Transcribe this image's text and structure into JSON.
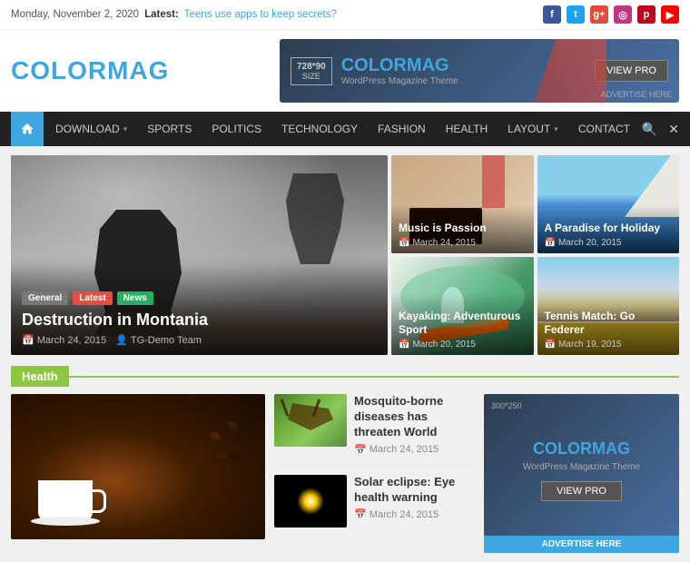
{
  "topbar": {
    "date": "Monday, November 2, 2020",
    "latest_label": "Latest:",
    "latest_link": "Teens use apps to keep secrets?",
    "social": [
      "fb",
      "tw",
      "gp",
      "ig",
      "pi",
      "yt"
    ]
  },
  "header": {
    "logo_black": "COLOR",
    "logo_blue": "MAG",
    "banner": {
      "size": "728*90",
      "size_sub": "SIZE",
      "logo_black": "COLOR",
      "logo_blue": "MAG",
      "tagline": "WordPress Magazine Theme",
      "btn_label": "VIEW PRO",
      "advertise": "ADVERTISE HERE"
    }
  },
  "nav": {
    "items": [
      {
        "label": "DOWNLOAD",
        "has_arrow": true
      },
      {
        "label": "SPORTS",
        "has_arrow": false
      },
      {
        "label": "POLITICS",
        "has_arrow": false
      },
      {
        "label": "TECHNOLOGY",
        "has_arrow": false
      },
      {
        "label": "FASHION",
        "has_arrow": false
      },
      {
        "label": "HEALTH",
        "has_arrow": false
      },
      {
        "label": "LAYOUT",
        "has_arrow": true
      },
      {
        "label": "CONTACT",
        "has_arrow": false
      }
    ]
  },
  "featured": {
    "tags": [
      "General",
      "Latest",
      "News"
    ],
    "title": "Destruction in Montania",
    "date": "March 24, 2015",
    "author": "TG-Demo Team"
  },
  "grid_items": [
    {
      "title": "Music is Passion",
      "date": "March 24, 2015",
      "scene": "piano"
    },
    {
      "title": "A Paradise for Holiday",
      "date": "March 20, 2015",
      "scene": "cliffs"
    },
    {
      "title": "Kayaking: Adventurous Sport",
      "date": "March 20, 2015",
      "scene": "kayak"
    },
    {
      "title": "Tennis Match: Go Federer",
      "date": "March 19, 2015",
      "scene": "tennis"
    }
  ],
  "health_section": {
    "label": "Health",
    "articles": [
      {
        "title": "Mosquito-borne diseases has threaten World",
        "date": "March 24, 2015",
        "scene": "mosquito"
      },
      {
        "title": "Solar eclipse: Eye health warning",
        "date": "March 24, 2015",
        "scene": "eclipse"
      }
    ]
  },
  "sidebar_ad": {
    "logo_black": "COLOR",
    "logo_blue": "MAG",
    "tagline": "WordPress Magazine Theme",
    "btn_label": "VIEW PRO",
    "size": "300*250",
    "advertise": "ADVERTISE HERE"
  }
}
